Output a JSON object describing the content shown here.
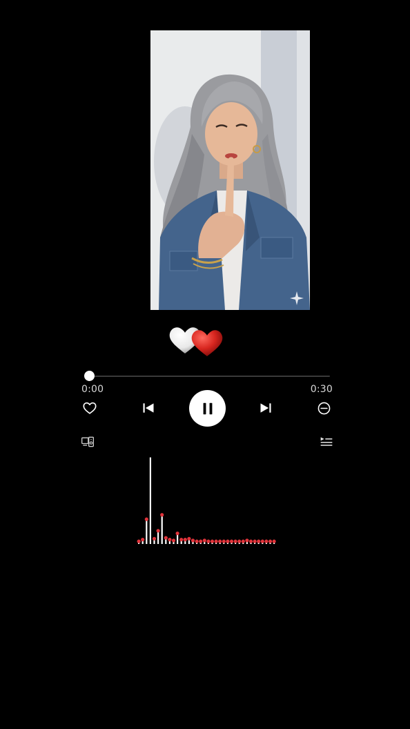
{
  "player": {
    "time_current": "0:00",
    "time_total": "0:30",
    "progress_fraction": 0.0
  },
  "icons": {
    "like": "heart-outline-icon",
    "previous": "skip-previous-icon",
    "play_state": "pause-icon",
    "next": "skip-next-icon",
    "remove": "minus-circle-icon",
    "device": "connect-device-icon",
    "queue": "queue-list-icon"
  },
  "colors": {
    "background": "#000000",
    "accent": "#ffffff",
    "heart_red": "#d8261f",
    "viz_cap": "#e0333a"
  },
  "visualizer": {
    "levels": [
      0.03,
      0.05,
      0.28,
      0.98,
      0.06,
      0.15,
      0.33,
      0.07,
      0.05,
      0.04,
      0.12,
      0.05,
      0.05,
      0.06,
      0.04,
      0.03,
      0.03,
      0.04,
      0.03,
      0.03,
      0.03,
      0.03,
      0.03,
      0.03,
      0.03,
      0.03,
      0.03,
      0.03,
      0.04,
      0.03,
      0.03,
      0.03,
      0.03,
      0.03,
      0.03,
      0.03
    ]
  }
}
